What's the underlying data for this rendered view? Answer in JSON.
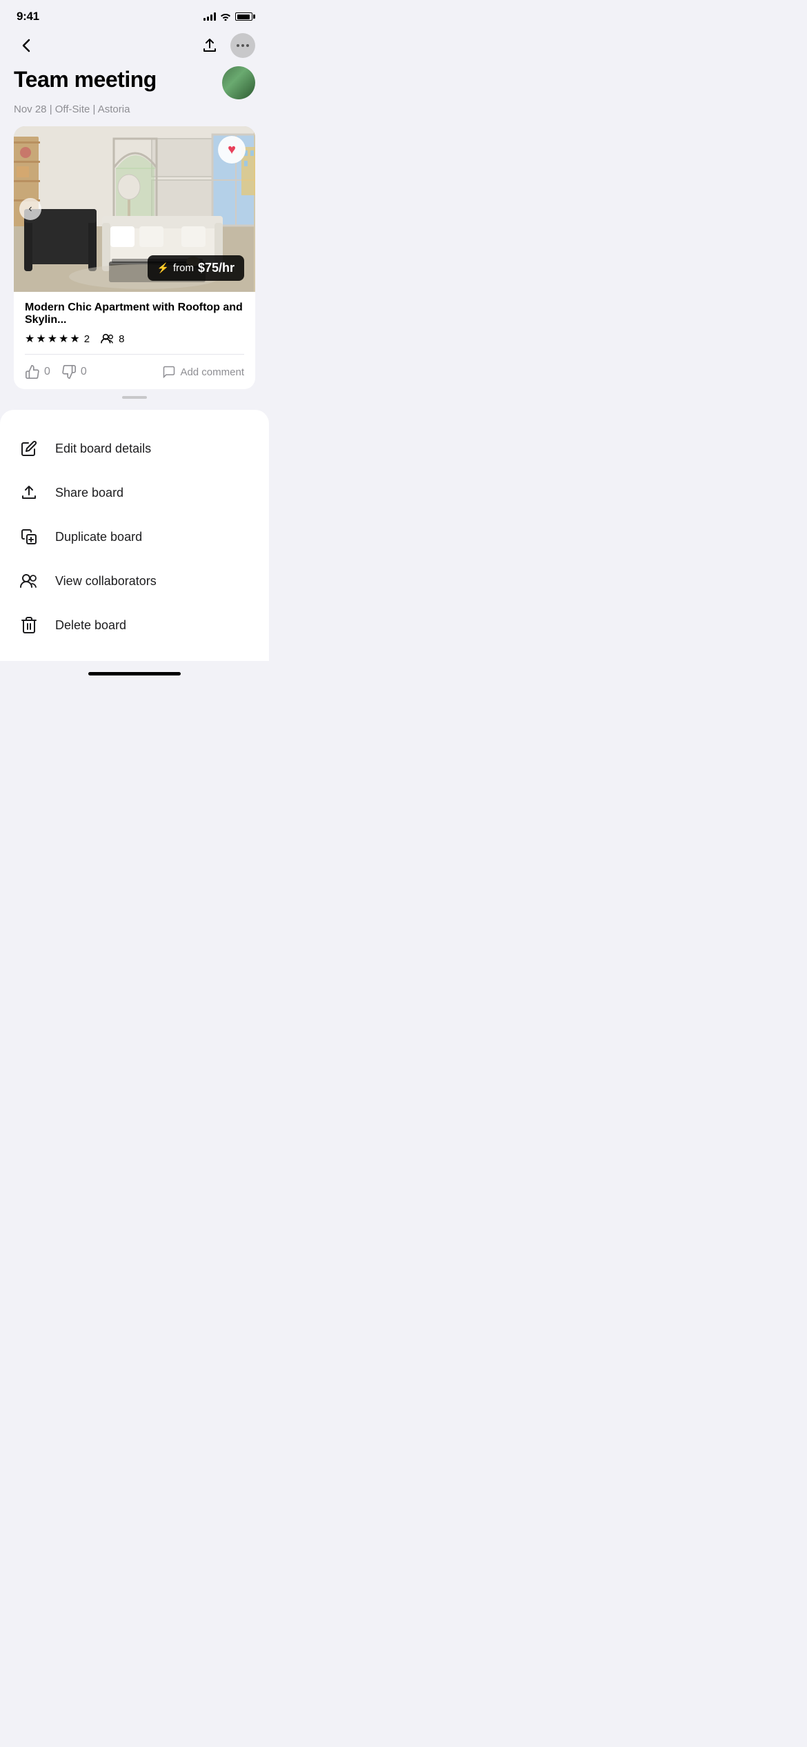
{
  "statusBar": {
    "time": "9:41"
  },
  "nav": {
    "backLabel": "‹",
    "uploadLabel": "upload",
    "moreLabel": "more"
  },
  "board": {
    "title": "Team meeting",
    "meta": "Nov 28 | Off-Site | Astoria"
  },
  "listing": {
    "title": "Modern Chic Apartment with Rooftop and Skylin...",
    "rating": 5,
    "reviewCount": "2",
    "capacity": "8",
    "price": "$75/hr",
    "pricePrefix": "from",
    "thumbsUp": "0",
    "thumbsDown": "0",
    "addCommentLabel": "Add comment"
  },
  "menu": {
    "items": [
      {
        "id": "edit-board",
        "label": "Edit board details",
        "icon": "pencil"
      },
      {
        "id": "share-board",
        "label": "Share board",
        "icon": "upload"
      },
      {
        "id": "duplicate-board",
        "label": "Duplicate board",
        "icon": "duplicate"
      },
      {
        "id": "view-collaborators",
        "label": "View collaborators",
        "icon": "people"
      },
      {
        "id": "delete-board",
        "label": "Delete board",
        "icon": "trash"
      }
    ]
  }
}
